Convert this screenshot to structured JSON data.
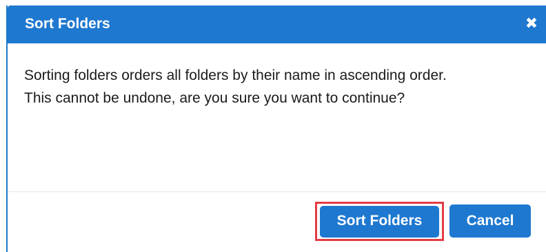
{
  "dialog": {
    "title": "Sort Folders",
    "close_glyph": "✖",
    "close_icon": "close-icon",
    "message_lines": [
      "Sorting folders orders all folders by their name in ascending order.",
      "This cannot be undone, are you sure you want to continue?"
    ],
    "buttons": {
      "confirm_label": "Sort Folders",
      "cancel_label": "Cancel"
    },
    "colors": {
      "header": "#1e78d0",
      "button": "#1e78d0",
      "highlight": "#e53b44"
    }
  }
}
